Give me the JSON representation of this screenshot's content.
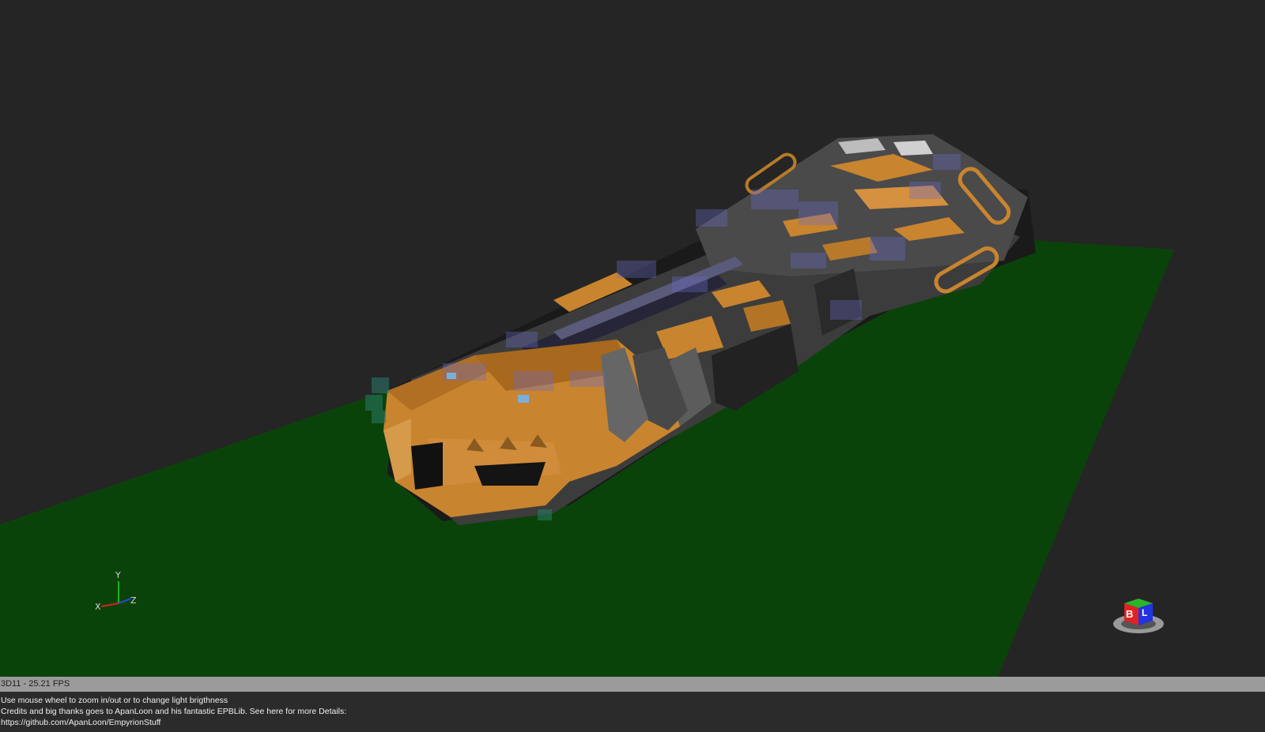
{
  "viewport": {
    "ground_color": "#0a430a",
    "background_color": "#252525",
    "model": {
      "hull_color": "#c8842e",
      "frame_color": "#555555",
      "glass_color": "#6b6bc8"
    }
  },
  "axis_gizmo": {
    "y_label": "Y",
    "x_label": "X",
    "z_label": "Z"
  },
  "view_cube": {
    "front_label": "B",
    "side_label": "L"
  },
  "status": {
    "text": "3D11 - 25.21 FPS"
  },
  "info": {
    "line1": "Use mouse wheel to zoom in/out or to change light brigthness",
    "line2": "Credits and big thanks goes to ApanLoon and his fantastic EPBLib. See here for more Details:",
    "link": "https://github.com/ApanLoon/EmpyrionStuff"
  }
}
